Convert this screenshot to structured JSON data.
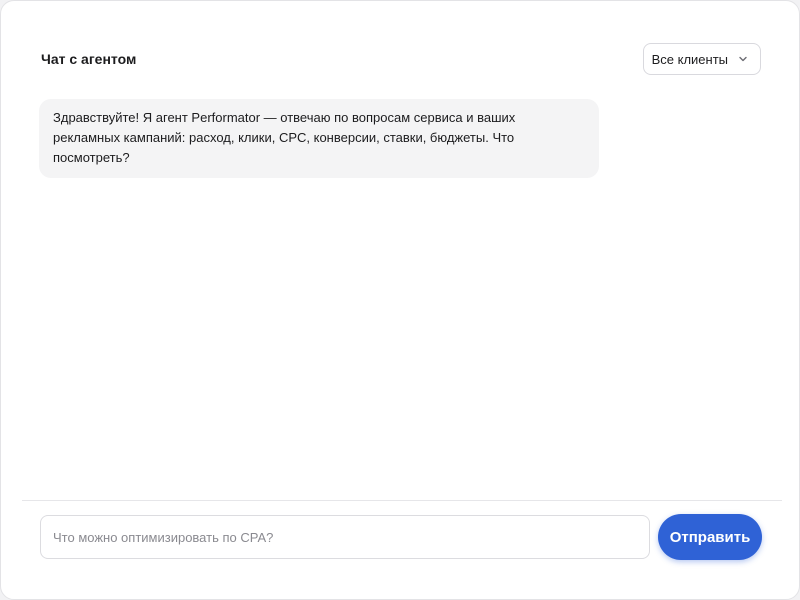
{
  "header": {
    "title": "Чат с агентом",
    "client_filter": {
      "selected": "Все клиенты",
      "icon": "chevron-down-icon"
    }
  },
  "messages": [
    {
      "role": "agent",
      "text": "Здравствуйте! Я агент Performator — отвечаю по вопросам сервиса и ваших рекламных кампаний: расход, клики, CPC, конверсии, ставки, бюджеты. Что посмотреть?"
    }
  ],
  "composer": {
    "value": "",
    "placeholder": "Что можно оптимизировать по CPA?",
    "send_label": "Отправить"
  },
  "colors": {
    "accent": "#2f62d6",
    "bubble_background": "#f4f4f5",
    "text": "#1c1c1e"
  }
}
